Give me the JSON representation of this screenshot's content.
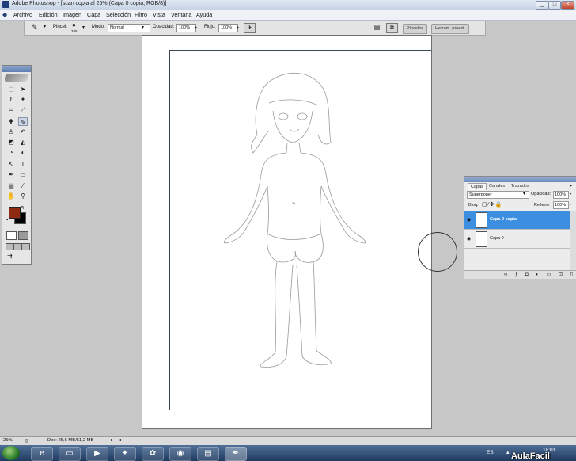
{
  "window": {
    "title": "Adobe Photoshop - [scan copia al 25% (Capa 0 copia, RGB/8)]",
    "controls": {
      "minimize": "_",
      "maximize": "□",
      "close": "×"
    }
  },
  "menubar": {
    "items": [
      "Archivo",
      "Edición",
      "Imagen",
      "Capa",
      "Selección",
      "Filtro",
      "Vista",
      "Ventana",
      "Ayuda"
    ]
  },
  "options_bar": {
    "brush_label": "Pincel:",
    "brush_size": "345",
    "mode_label": "Modo:",
    "mode_value": "Normal",
    "opacity_label": "Opacidad:",
    "opacity_value": "100%",
    "flow_label": "Flujo:",
    "flow_value": "100%",
    "tabs": [
      "Pinceles",
      "Herram. preest."
    ]
  },
  "tools": {
    "foreground_color": "#8e2a12",
    "background_color": "#000000",
    "icons": [
      [
        "marquee-icon",
        "move-icon"
      ],
      [
        "lasso-icon",
        "magic-wand-icon"
      ],
      [
        "crop-icon",
        "slice-icon"
      ],
      [
        "healing-brush-icon",
        "brush-icon"
      ],
      [
        "clone-stamp-icon",
        "history-brush-icon"
      ],
      [
        "eraser-icon",
        "paint-bucket-icon"
      ],
      [
        "blur-icon",
        "dodge-icon"
      ],
      [
        "path-selection-icon",
        "type-icon"
      ],
      [
        "pen-icon",
        "shape-icon"
      ],
      [
        "notes-icon",
        "eyedropper-icon"
      ],
      [
        "hand-icon",
        "zoom-icon"
      ]
    ]
  },
  "layers_panel": {
    "tabs": [
      "Capas",
      "Canales",
      "Trazados"
    ],
    "blend_mode": "Superponer",
    "opacity_label": "Opacidad:",
    "opacity_value": "100%",
    "lock_label": "Bloq.:",
    "fill_label": "Relleno:",
    "fill_value": "100%",
    "layers": [
      {
        "name": "Capa 0 copia",
        "selected": true
      },
      {
        "name": "Capa 0",
        "selected": false
      }
    ]
  },
  "status_bar": {
    "zoom": "25%",
    "doc_info": "Doc: 25,6 MB/51,2 MB"
  },
  "taskbar": {
    "language": "ES",
    "time": "18:01",
    "watermark": "AulaFacil"
  },
  "colors": {
    "selected_layer": "#3c8fe0",
    "workspace": "#c7c7c7",
    "taskbar": "#2a4670"
  }
}
